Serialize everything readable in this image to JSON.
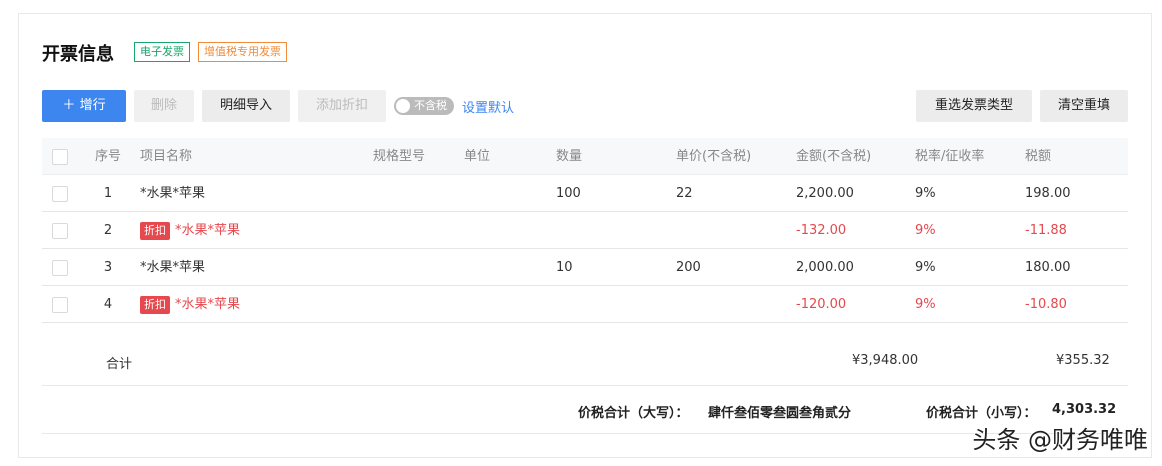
{
  "title": "开票信息",
  "tags": [
    {
      "label": "电子发票",
      "color": "#1aa56a"
    },
    {
      "label": "增值税专用发票",
      "color": "#f08c3a"
    }
  ],
  "toolbar": {
    "add_row": "增行",
    "delete": "删除",
    "import": "明细导入",
    "add_discount": "添加折扣",
    "tax_toggle": "不含税",
    "set_default": "设置默认",
    "reselect_type": "重选发票类型",
    "clear": "清空重填"
  },
  "table": {
    "columns": [
      "序号",
      "项目名称",
      "规格型号",
      "单位",
      "数量",
      "单价(不含税)",
      "金额(不含税)",
      "税率/征收率",
      "税额"
    ],
    "rows": [
      {
        "no": "1",
        "discount": false,
        "name": "*水果*苹果",
        "spec": "",
        "unit": "",
        "qty": "100",
        "price": "22",
        "amount": "2,200.00",
        "rate": "9%",
        "tax": "198.00"
      },
      {
        "no": "2",
        "discount": true,
        "name": "*水果*苹果",
        "spec": "",
        "unit": "",
        "qty": "",
        "price": "",
        "amount": "-132.00",
        "rate": "9%",
        "tax": "-11.88"
      },
      {
        "no": "3",
        "discount": false,
        "name": "*水果*苹果",
        "spec": "",
        "unit": "",
        "qty": "10",
        "price": "200",
        "amount": "2,000.00",
        "rate": "9%",
        "tax": "180.00"
      },
      {
        "no": "4",
        "discount": true,
        "name": "*水果*苹果",
        "spec": "",
        "unit": "",
        "qty": "",
        "price": "",
        "amount": "-120.00",
        "rate": "9%",
        "tax": "-10.80"
      }
    ],
    "discount_badge": "折扣"
  },
  "summary": {
    "label": "合计",
    "amount": "¥3,948.00",
    "tax": "¥355.32"
  },
  "total": {
    "upper_label": "价税合计（大写）：",
    "upper_value": "肆仟叁佰零叁圆叁角贰分",
    "lower_label": "价税合计（小写）：",
    "lower_value": "4,303.32"
  },
  "watermark": "头条 @财务唯唯"
}
